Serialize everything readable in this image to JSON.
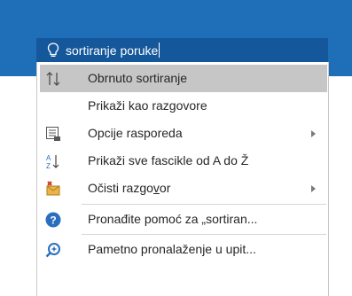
{
  "search": {
    "value": "sortiranje poruke",
    "icon": "lightbulb-icon"
  },
  "menu": {
    "items": [
      {
        "label": "Obrnuto sortiranje",
        "icon": "sort-reverse-icon",
        "selected": true,
        "submenu": false
      },
      {
        "label": "Prikaži kao razgovore",
        "icon": "",
        "selected": false,
        "submenu": false
      },
      {
        "label": "Opcije rasporeda",
        "icon": "layout-options-icon",
        "selected": false,
        "submenu": true
      },
      {
        "label": "Prikaži sve fascikle od A do Ž",
        "icon": "sort-az-icon",
        "selected": false,
        "submenu": false
      },
      {
        "label_before": "Očisti razgo",
        "label_underlined": "v",
        "label_after": "or",
        "icon": "clean-up-mail-icon",
        "selected": false,
        "submenu": true
      },
      {
        "label": "Pronađite pomoć za „sortiran...",
        "icon": "help-icon",
        "selected": false,
        "submenu": false
      },
      {
        "label": "Pametno pronalaženje u upit...",
        "icon": "smart-lookup-icon",
        "selected": false,
        "submenu": false
      }
    ]
  },
  "colors": {
    "header": "#1e6fb8",
    "search_box": "#15579b",
    "selected_row": "#c6c6c6",
    "help_icon": "#2a6fbf"
  }
}
